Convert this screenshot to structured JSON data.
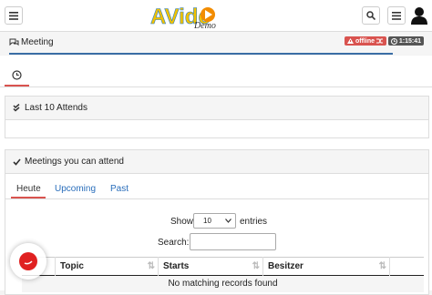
{
  "header": {
    "menu_icon": "hamburger-icon",
    "search_icon": "search-icon",
    "user_icon": "user-icon",
    "logo_main": "AVideo",
    "logo_sub": "Demo"
  },
  "meeting_bar": {
    "icon": "comments-icon",
    "title": "Meeting",
    "offline_label": "offline",
    "timer": "1:15:41",
    "offline_color": "#d9534f",
    "timer_color": "#555555"
  },
  "tabs_top": {
    "clock_icon": "clock-icon"
  },
  "last_attends": {
    "icon": "double-check-icon",
    "title": "Last 10 Attends"
  },
  "meetings": {
    "icon": "check-icon",
    "title": "Meetings you can attend",
    "tabs": [
      "Heute",
      "Upcoming",
      "Past"
    ],
    "active_tab": "Heute",
    "show_label": "Show",
    "entries_value": "10",
    "entries_label": "entries",
    "search_label": "Search:",
    "search_value": "",
    "columns": [
      "Topic",
      "Starts",
      "Besitzer"
    ],
    "empty_message": "No matching records found"
  },
  "fab": {
    "icon": "chat-icon",
    "color": "#e02020"
  }
}
